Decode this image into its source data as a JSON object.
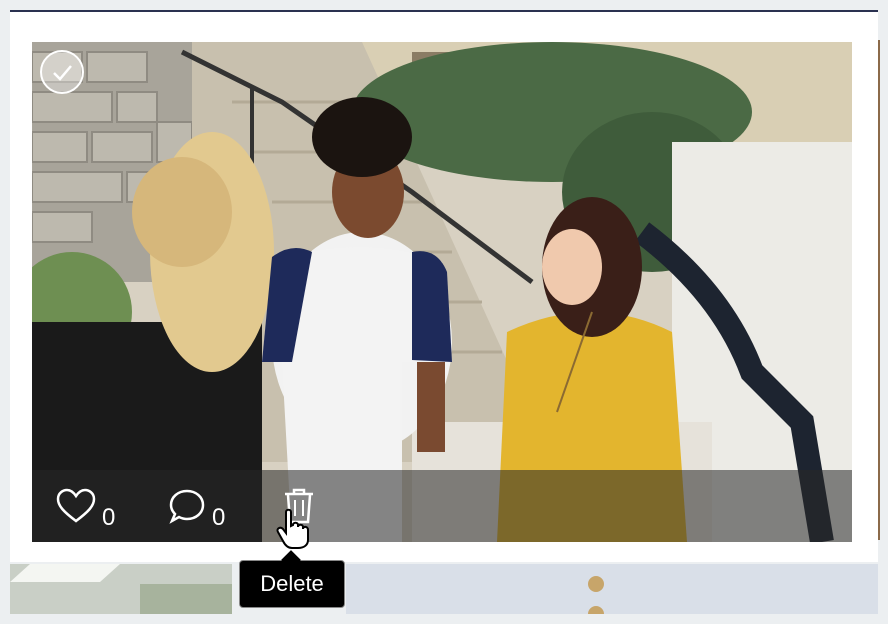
{
  "post": {
    "likes": "0",
    "comments": "0",
    "tooltip": "Delete"
  },
  "icons": {
    "select": "check-icon",
    "like": "heart-icon",
    "comment": "comment-bubble-icon",
    "delete": "trash-icon"
  },
  "colors": {
    "overlay": "#282828",
    "tooltip_bg": "#000000",
    "card_border": "#2a3150"
  }
}
